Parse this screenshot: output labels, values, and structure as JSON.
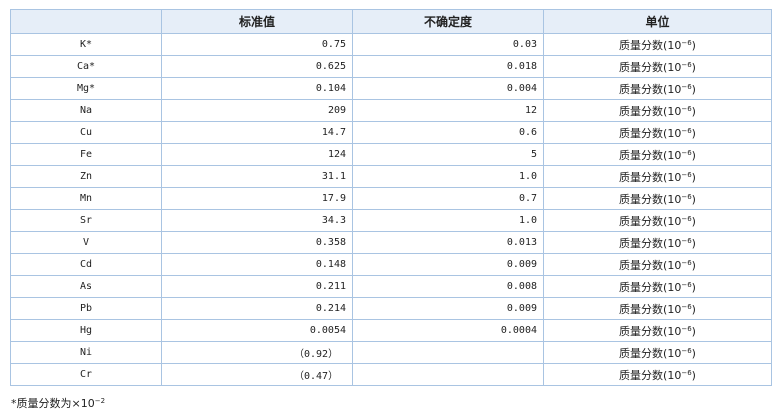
{
  "table": {
    "headers": [
      "",
      "标准值",
      "不确定度",
      "单位"
    ],
    "unit_base": "质量分数(10",
    "unit_exp": "−6",
    "unit_close": ")",
    "rows": [
      {
        "element": "K*",
        "value": "0.75",
        "uncertainty": "0.03",
        "paren": false
      },
      {
        "element": "Ca*",
        "value": "0.625",
        "uncertainty": "0.018",
        "paren": false
      },
      {
        "element": "Mg*",
        "value": "0.104",
        "uncertainty": "0.004",
        "paren": false
      },
      {
        "element": "Na",
        "value": "209",
        "uncertainty": "12",
        "paren": false
      },
      {
        "element": "Cu",
        "value": "14.7",
        "uncertainty": "0.6",
        "paren": false
      },
      {
        "element": "Fe",
        "value": "124",
        "uncertainty": "5",
        "paren": false
      },
      {
        "element": "Zn",
        "value": "31.1",
        "uncertainty": "1.0",
        "paren": false
      },
      {
        "element": "Mn",
        "value": "17.9",
        "uncertainty": "0.7",
        "paren": false
      },
      {
        "element": "Sr",
        "value": "34.3",
        "uncertainty": "1.0",
        "paren": false
      },
      {
        "element": "V",
        "value": "0.358",
        "uncertainty": "0.013",
        "paren": false
      },
      {
        "element": "Cd",
        "value": "0.148",
        "uncertainty": "0.009",
        "paren": false
      },
      {
        "element": "As",
        "value": "0.211",
        "uncertainty": "0.008",
        "paren": false
      },
      {
        "element": "Pb",
        "value": "0.214",
        "uncertainty": "0.009",
        "paren": false
      },
      {
        "element": "Hg",
        "value": "0.0054",
        "uncertainty": "0.0004",
        "paren": false
      },
      {
        "element": "Ni",
        "value": "（0.92）",
        "uncertainty": "",
        "paren": true
      },
      {
        "element": "Cr",
        "value": "（0.47）",
        "uncertainty": "",
        "paren": true
      }
    ]
  },
  "footnote": {
    "text": "*质量分数为×10",
    "exp": "−2"
  }
}
